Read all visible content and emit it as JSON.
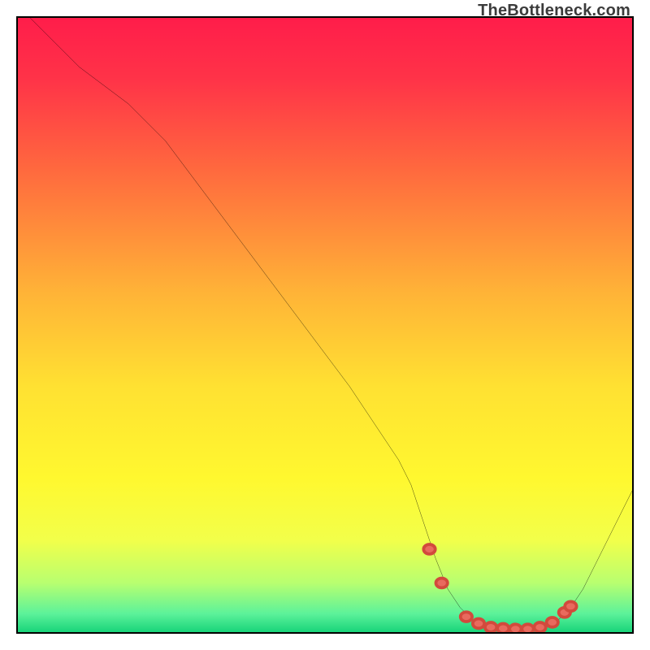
{
  "watermark": "TheBottleneck.com",
  "colors": {
    "gradient_stops": [
      {
        "offset": 0.0,
        "color": "#ff1d4a"
      },
      {
        "offset": 0.1,
        "color": "#ff3348"
      },
      {
        "offset": 0.25,
        "color": "#ff6a3e"
      },
      {
        "offset": 0.45,
        "color": "#ffb437"
      },
      {
        "offset": 0.6,
        "color": "#ffe132"
      },
      {
        "offset": 0.75,
        "color": "#fff82f"
      },
      {
        "offset": 0.85,
        "color": "#f2ff4a"
      },
      {
        "offset": 0.92,
        "color": "#b8ff70"
      },
      {
        "offset": 0.97,
        "color": "#5cf29a"
      },
      {
        "offset": 1.0,
        "color": "#18d47a"
      }
    ],
    "curve": "#000000",
    "marker_fill": "#e96a5e",
    "marker_stroke": "#d24a3c"
  },
  "chart_data": {
    "type": "line",
    "title": "",
    "xlabel": "",
    "ylabel": "",
    "xlim": [
      0,
      100
    ],
    "ylim": [
      0,
      100
    ],
    "series": [
      {
        "name": "bottleneck-curve",
        "x": [
          2,
          6,
          10,
          14,
          18,
          24,
          30,
          36,
          42,
          48,
          54,
          60,
          62,
          64,
          66,
          68,
          70,
          72,
          74,
          76,
          78,
          80,
          82,
          84,
          86,
          88,
          90,
          92,
          94,
          96,
          98,
          100
        ],
        "y": [
          100,
          96,
          92,
          89,
          86,
          80,
          72,
          64,
          56,
          48,
          40,
          31,
          28,
          24,
          18,
          12,
          7,
          4,
          2,
          1,
          0.6,
          0.5,
          0.5,
          0.6,
          1,
          2,
          4,
          7,
          11,
          15,
          19,
          23
        ]
      }
    ],
    "markers": {
      "name": "highlight-dots",
      "x": [
        67,
        69,
        73,
        75,
        77,
        79,
        81,
        83,
        85,
        87,
        89,
        90
      ],
      "y": [
        13.5,
        8,
        2.5,
        1.4,
        0.8,
        0.6,
        0.5,
        0.5,
        0.8,
        1.6,
        3.2,
        4.2
      ]
    }
  }
}
